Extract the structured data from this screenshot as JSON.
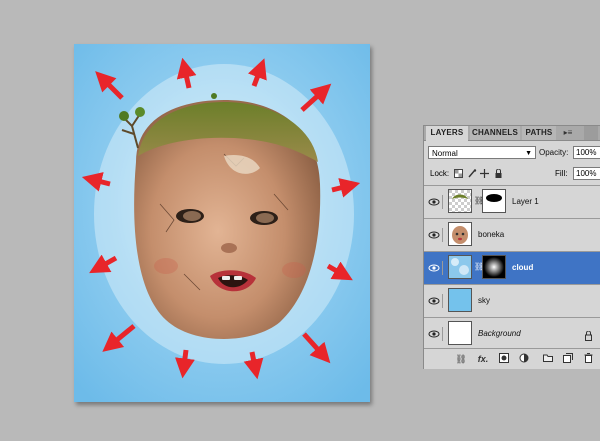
{
  "layers_panel": {
    "tabs": [
      {
        "label": "LAYERS",
        "active": true
      },
      {
        "label": "CHANNELS",
        "active": false
      },
      {
        "label": "PATHS",
        "active": false
      }
    ],
    "menu_glyph": "▸≡",
    "blend_mode": "Normal",
    "opacity_label": "Opacity:",
    "opacity_value": "100%",
    "lock_label": "Lock:",
    "fill_label": "Fill:",
    "fill_value": "100%",
    "layers": [
      {
        "name": "Layer 1",
        "visible": true,
        "selected": false,
        "has_mask": true,
        "italic": false,
        "locked": false
      },
      {
        "name": "boneka",
        "visible": true,
        "selected": false,
        "has_mask": false,
        "italic": false,
        "locked": false
      },
      {
        "name": "cloud",
        "visible": true,
        "selected": true,
        "has_mask": true,
        "italic": false,
        "locked": false
      },
      {
        "name": "sky",
        "visible": true,
        "selected": false,
        "has_mask": false,
        "italic": false,
        "locked": false
      },
      {
        "name": "Background",
        "visible": true,
        "selected": false,
        "has_mask": false,
        "italic": true,
        "locked": true
      }
    ],
    "footer_icons": [
      "link-layers-icon",
      "fx-icon",
      "add-mask-icon",
      "adjustment-layer-icon",
      "new-group-icon",
      "new-layer-icon",
      "trash-icon"
    ],
    "footer_fx_label": "fx."
  },
  "colors": {
    "workspace": "#b9b9b9",
    "sky_blue": "#74c2ec",
    "arrow_red": "#e8252a",
    "selection_blue": "#3f74c5"
  }
}
